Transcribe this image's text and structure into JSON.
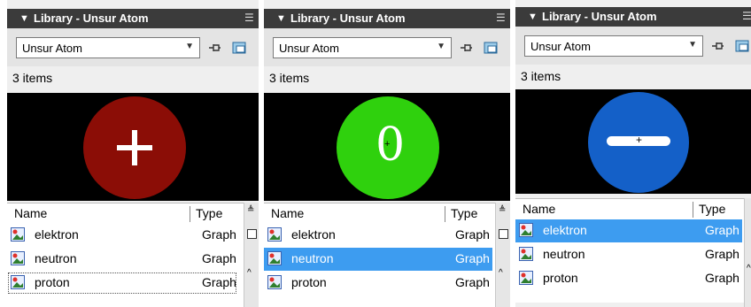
{
  "panels": [
    {
      "title": "Library - Unsur Atom",
      "dropdown_value": "Unsur Atom",
      "item_count": "3 items",
      "preview": {
        "symbol": "+",
        "color": "#8b0d06"
      },
      "columns": {
        "name": "Name",
        "type": "Type"
      },
      "items": [
        {
          "name": "elektron",
          "type": "Graph"
        },
        {
          "name": "neutron",
          "type": "Graph"
        },
        {
          "name": "proton",
          "type": "Graph"
        }
      ],
      "selected": -1
    },
    {
      "title": "Library - Unsur Atom",
      "dropdown_value": "Unsur Atom",
      "item_count": "3 items",
      "preview": {
        "symbol": "0",
        "color": "#2fd10d"
      },
      "columns": {
        "name": "Name",
        "type": "Type"
      },
      "items": [
        {
          "name": "elektron",
          "type": "Graph"
        },
        {
          "name": "neutron",
          "type": "Graph"
        },
        {
          "name": "proton",
          "type": "Graph"
        }
      ],
      "selected": 1
    },
    {
      "title": "Library - Unsur Atom",
      "dropdown_value": "Unsur Atom",
      "item_count": "3 items",
      "preview": {
        "symbol": "-",
        "color": "#1460c8"
      },
      "columns": {
        "name": "Name",
        "type": "Type"
      },
      "items": [
        {
          "name": "elektron",
          "type": "Graph"
        },
        {
          "name": "neutron",
          "type": "Graph"
        },
        {
          "name": "proton",
          "type": "Graph"
        }
      ],
      "selected": 0
    }
  ]
}
